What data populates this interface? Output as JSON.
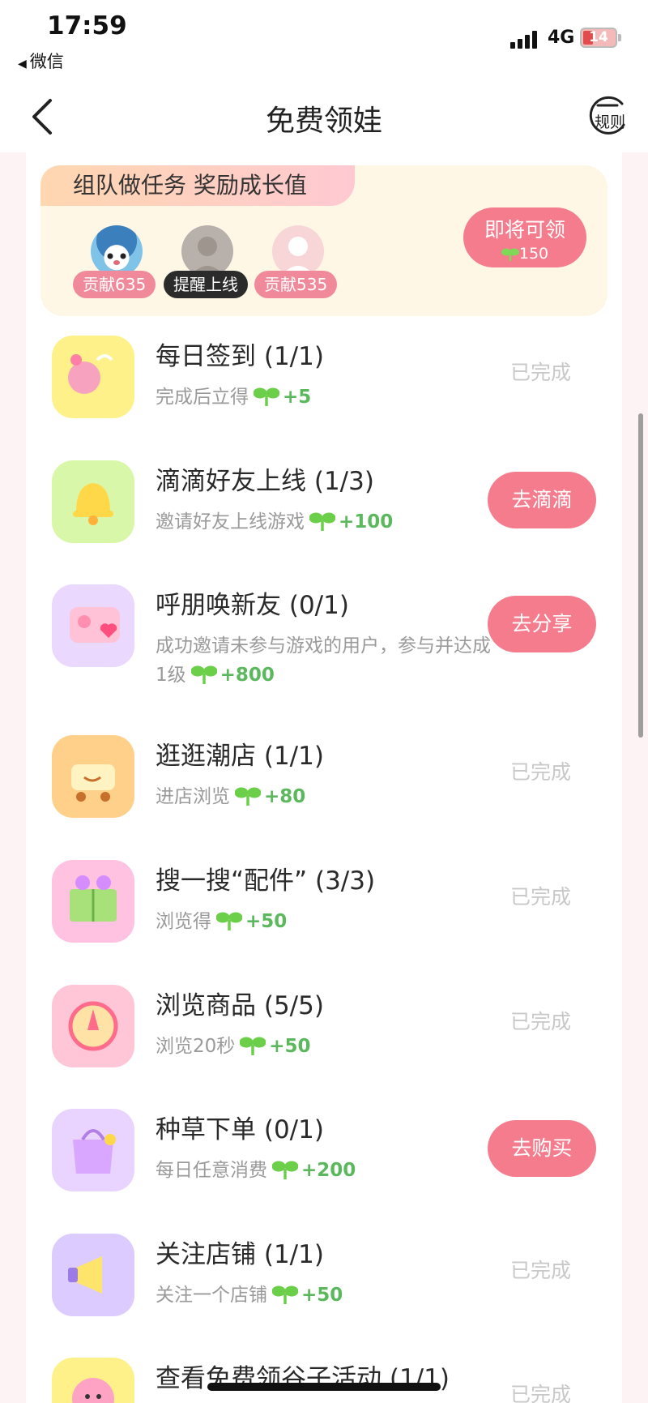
{
  "status_bar": {
    "time": "17:59",
    "back_app": "微信",
    "network": "4G",
    "battery": "14"
  },
  "nav": {
    "title": "免费领娃",
    "rules_label": "规则"
  },
  "team": {
    "banner": "组队做任务 奖励成长值",
    "members": [
      {
        "tag": "贡献635",
        "tag_color": "#f08a9b"
      },
      {
        "tag": "提醒上线",
        "tag_color": "#2b2b2b"
      },
      {
        "tag": "贡献535",
        "tag_color": "#f08a9b"
      }
    ],
    "claim": {
      "label": "即将可领",
      "amount": "150"
    }
  },
  "tasks": [
    {
      "title": "每日签到 (1/1)",
      "desc": "完成后立得",
      "reward": "+5",
      "status": "已完成",
      "action": "",
      "icon": "hands-icon",
      "icon_bg": "#fff18a"
    },
    {
      "title": "滴滴好友上线 (1/3)",
      "desc": "邀请好友上线游戏",
      "reward": "+100",
      "status": "",
      "action": "去滴滴",
      "icon": "bell-icon",
      "icon_bg": "#d9f7a8"
    },
    {
      "title": "呼朋唤新友 (0/1)",
      "desc": "成功邀请未参与游戏的用户，参与并达成1级",
      "reward": "+800",
      "status": "",
      "action": "去分享",
      "icon": "card-heart-icon",
      "icon_bg": "#ead8ff"
    },
    {
      "title": "逛逛潮店 (1/1)",
      "desc": "进店浏览",
      "reward": "+80",
      "status": "已完成",
      "action": "",
      "icon": "cart-icon",
      "icon_bg": "#ffd08a"
    },
    {
      "title": "搜一搜“配件” (3/3)",
      "desc": "浏览得",
      "reward": "+50",
      "status": "已完成",
      "action": "",
      "icon": "book-icon",
      "icon_bg": "#ffc2e0"
    },
    {
      "title": "浏览商品 (5/5)",
      "desc": "浏览20秒",
      "reward": "+50",
      "status": "已完成",
      "action": "",
      "icon": "compass-icon",
      "icon_bg": "#ffc6d8"
    },
    {
      "title": "种草下单 (0/1)",
      "desc": "每日任意消费",
      "reward": "+200",
      "status": "",
      "action": "去购买",
      "icon": "shopping-bag-icon",
      "icon_bg": "#e9d3ff"
    },
    {
      "title": "关注店铺 (1/1)",
      "desc": "关注一个店铺",
      "reward": "+50",
      "status": "已完成",
      "action": "",
      "icon": "megaphone-icon",
      "icon_bg": "#dccbff"
    },
    {
      "title": "查看免费领谷子活动 (1/1)",
      "desc": "",
      "reward": "",
      "status": "已完成",
      "action": "",
      "icon": "flower-icon",
      "icon_bg": "#fff18a"
    }
  ]
}
